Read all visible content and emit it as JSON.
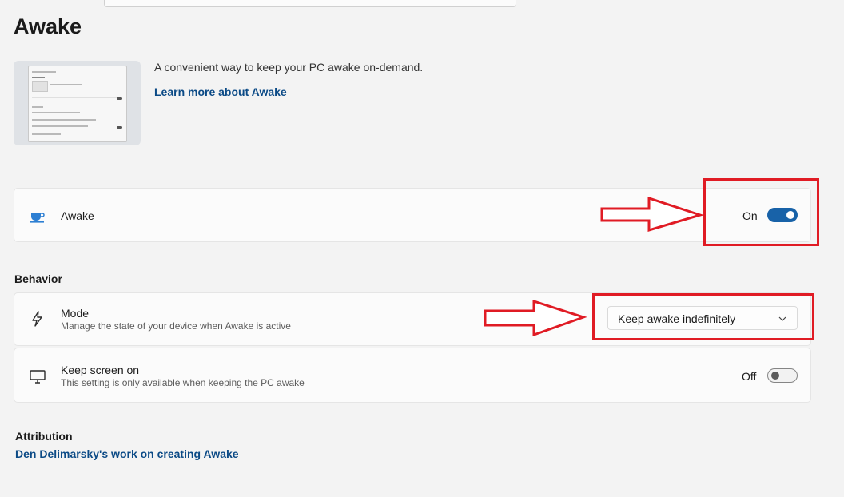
{
  "page": {
    "title": "Awake"
  },
  "hero": {
    "description": "A convenient way to keep your PC awake on-demand.",
    "learn_more": "Learn more about Awake"
  },
  "awake_card": {
    "title": "Awake",
    "toggle_state": "On",
    "enabled": true
  },
  "behavior": {
    "header": "Behavior",
    "mode": {
      "title": "Mode",
      "subtitle": "Manage the state of your device when Awake is active",
      "selected": "Keep awake indefinitely"
    },
    "keep_screen_on": {
      "title": "Keep screen on",
      "subtitle": "This setting is only available when keeping the PC awake",
      "toggle_state": "Off",
      "enabled": false
    }
  },
  "attribution": {
    "header": "Attribution",
    "link": "Den Delimarsky's work on creating Awake"
  },
  "icons": {
    "awake": "coffee-cup-icon",
    "mode": "lightning-icon",
    "screen": "monitor-icon",
    "dropdown": "chevron-down-icon"
  },
  "colors": {
    "accent": "#1862a8",
    "link": "#0b4a86",
    "annotation": "#e01b24",
    "background": "#f3f3f3"
  }
}
